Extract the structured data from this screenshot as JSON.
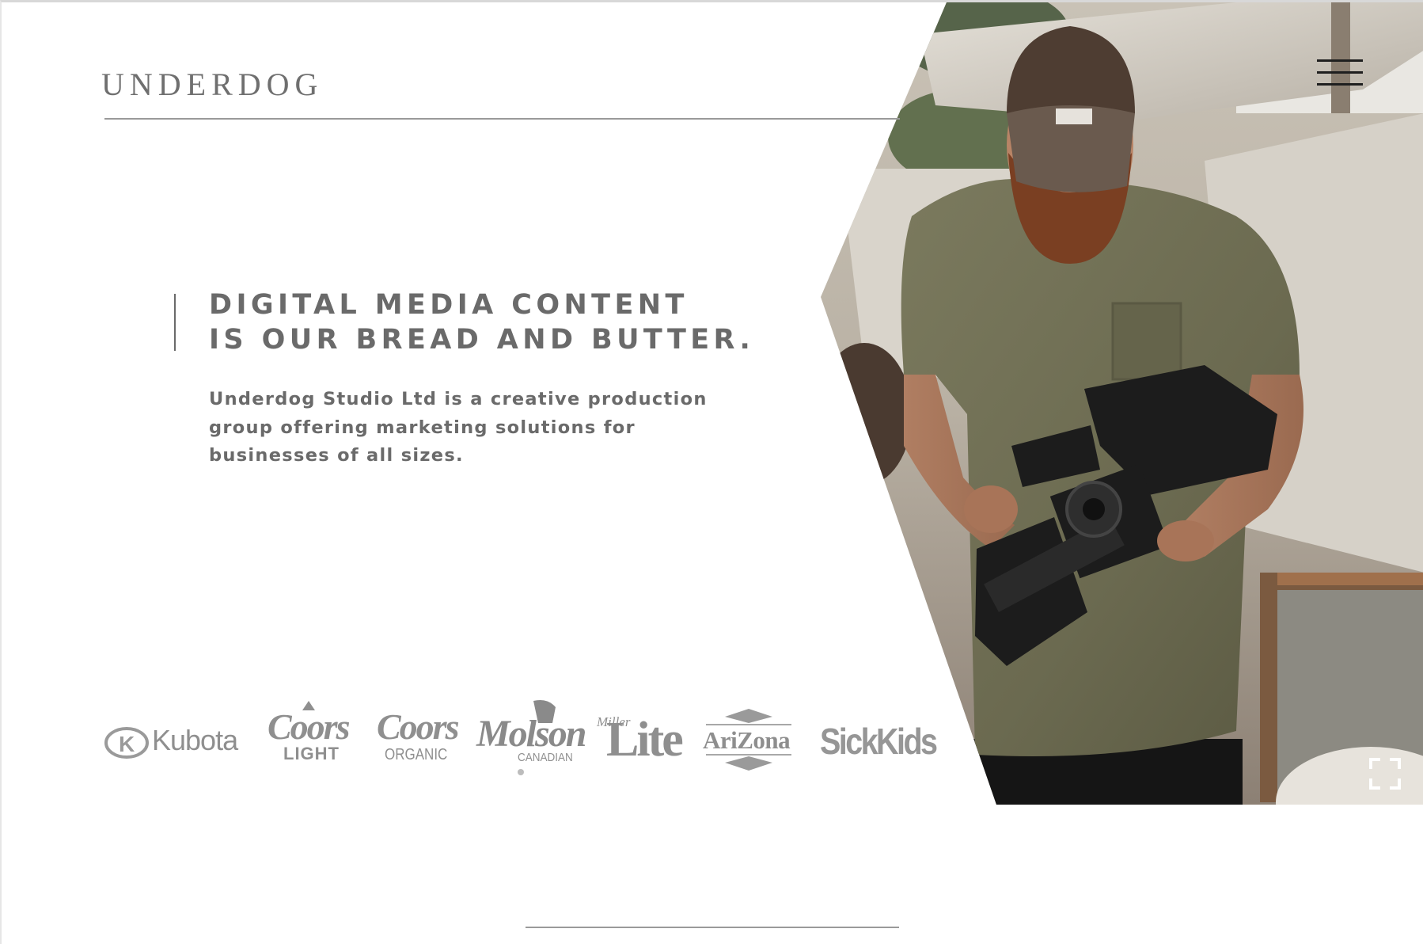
{
  "brand": {
    "name": "UNDERDOG"
  },
  "hero": {
    "headline_line1": "DIGITAL MEDIA CONTENT",
    "headline_line2": "IS OUR BREAD AND BUTTER.",
    "description": "Underdog Studio Ltd is a creative production group offering marketing solutions for businesses of all sizes.",
    "photo_icon": "camera-operator-photo"
  },
  "clients": {
    "logos": [
      {
        "id": "kubota",
        "text": "Kubota"
      },
      {
        "id": "coors-light",
        "text1": "Coors",
        "text2": "LIGHT"
      },
      {
        "id": "coors-organic",
        "text1": "Coors",
        "text2": "ORGANIC"
      },
      {
        "id": "molson",
        "text1": "Molson",
        "text2": "CANADIAN"
      },
      {
        "id": "miller-lite",
        "text1": "Miller",
        "text2": "Lite"
      },
      {
        "id": "arizona",
        "text": "AriZona"
      },
      {
        "id": "sickkids",
        "text": "SickKids"
      }
    ]
  },
  "controls": {
    "menu_icon": "hamburger-menu-icon",
    "expand_icon": "fullscreen-expand-icon"
  },
  "colors": {
    "text_gray": "#6a6a6a",
    "logo_gray": "#8a8a8a",
    "background": "#ffffff",
    "menu_icon": "#1f1f1f"
  }
}
